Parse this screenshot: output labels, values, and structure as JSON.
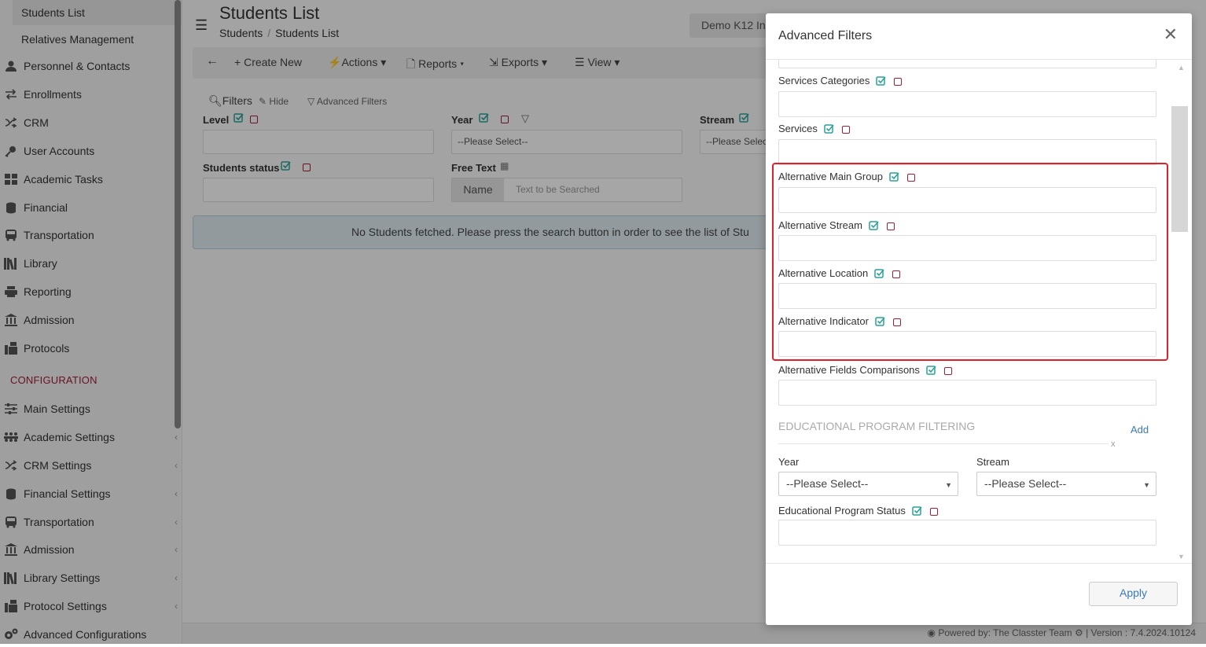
{
  "sidebar": {
    "sub_items": [
      "Students List",
      "Relatives Management"
    ],
    "items": [
      "Personnel & Contacts",
      "Enrollments",
      "CRM",
      "User Accounts",
      "Academic Tasks",
      "Financial",
      "Transportation",
      "Library",
      "Reporting",
      "Admission",
      "Protocols"
    ],
    "section_title": "CONFIGURATION",
    "config_items": [
      "Main Settings",
      "Academic Settings",
      "CRM Settings",
      "Financial Settings",
      "Transportation",
      "Admission",
      "Library Settings",
      "Protocol Settings",
      "Advanced Configurations"
    ]
  },
  "header": {
    "title": "Students List",
    "breadcrumb": [
      "Students",
      "Students List"
    ],
    "org": "Demo K12 In"
  },
  "toolbar": {
    "create": "Create New",
    "actions": "Actions",
    "reports": "Reports",
    "exports": "Exports",
    "view": "View"
  },
  "filters": {
    "title": "Filters",
    "hide": "Hide",
    "advanced": "Advanced Filters",
    "level": "Level",
    "year": "Year",
    "year_value": "--Please Select--",
    "stream": "Stream",
    "stream_value": "--Please Selec",
    "status": "Students status",
    "free_text": "Free Text",
    "name_addon": "Name",
    "text_placeholder": "Text to be Searched"
  },
  "notice": "No Students fetched. Please press the search button in order to see the list of Stu",
  "footer": {
    "powered": "Powered by: The Classter Team",
    "version": "| Version : 7.4.2024.10124"
  },
  "modal": {
    "title": "Advanced Filters",
    "fields": [
      "Services Categories",
      "Services",
      "Alternative Main Group",
      "Alternative Stream",
      "Alternative Location",
      "Alternative Indicator",
      "Alternative Fields Comparisons"
    ],
    "edu_title": "EDUCATIONAL PROGRAM FILTERING",
    "add": "Add",
    "x": "x",
    "year_label": "Year",
    "stream_label": "Stream",
    "year_value": "--Please Select--",
    "stream_value": "--Please Select--",
    "edu_status": "Educational Program Status",
    "apply": "Apply"
  },
  "colors": {
    "accent_teal": "#2aa198",
    "checkbox_red": "#a01e36",
    "highlight_red": "#e0202b",
    "link_blue": "#3b7ab8"
  }
}
